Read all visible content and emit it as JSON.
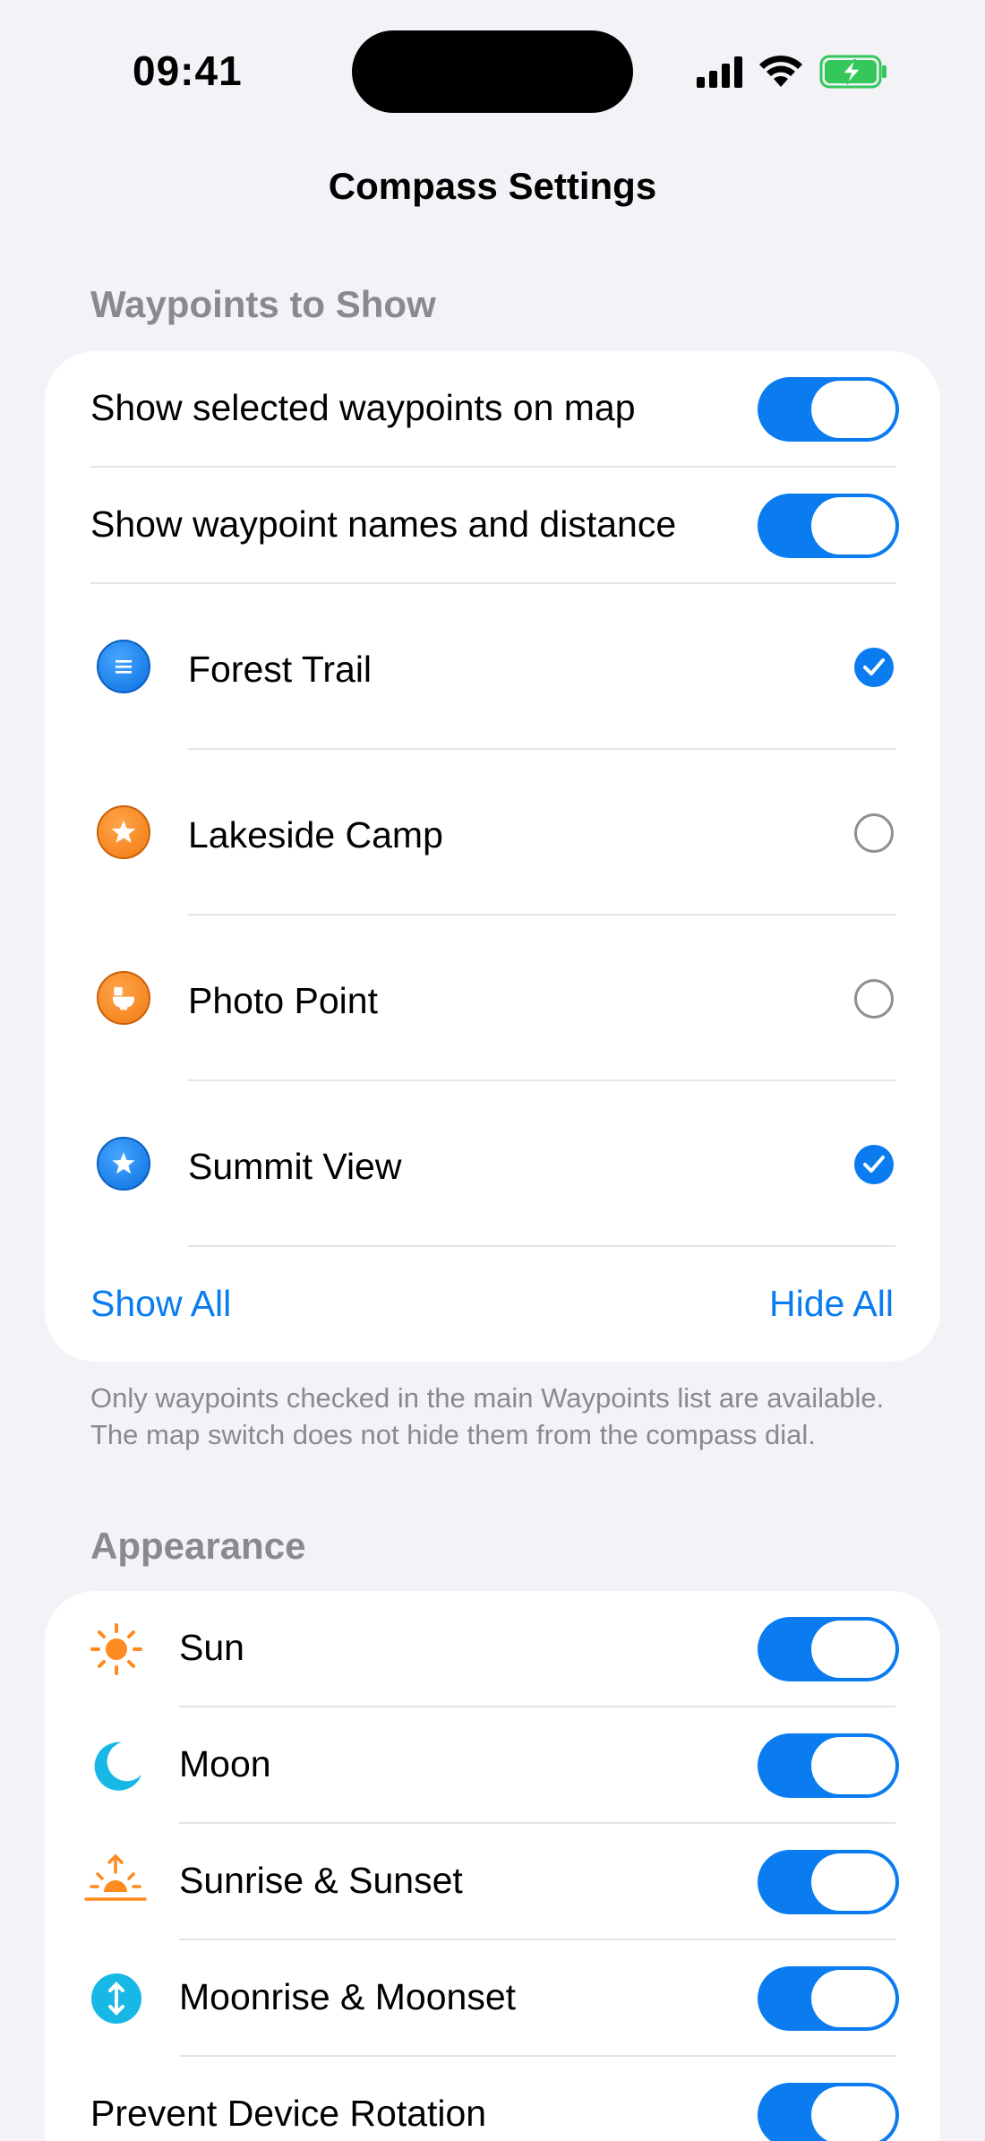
{
  "status": {
    "time": "09:41"
  },
  "nav": {
    "title": "Compass Settings"
  },
  "waypoints_section": {
    "header": "Waypoints to Show",
    "toggles": [
      {
        "label": "Show selected waypoints on map",
        "on": true
      },
      {
        "label": "Show waypoint names and distance",
        "on": true
      }
    ],
    "items": [
      {
        "label": "Forest Trail",
        "icon": "list-icon",
        "checked": true
      },
      {
        "label": "Lakeside Camp",
        "icon": "star-icon",
        "checked": false
      },
      {
        "label": "Photo Point",
        "icon": "restroom-icon",
        "checked": false
      },
      {
        "label": "Summit View",
        "icon": "star-icon",
        "checked": true
      }
    ],
    "show_all": "Show All",
    "hide_all": "Hide All",
    "footnote": "Only waypoints checked in the main Waypoints list are available. The map switch does not hide them from the compass dial."
  },
  "appearance_section": {
    "header": "Appearance",
    "rows": [
      {
        "label": "Sun",
        "icon": "sun-icon",
        "on": true
      },
      {
        "label": "Moon",
        "icon": "moon-icon",
        "on": true
      },
      {
        "label": "Sunrise & Sunset",
        "icon": "sunrise-icon",
        "on": true
      },
      {
        "label": "Moonrise & Moonset",
        "icon": "moonrise-icon",
        "on": true
      },
      {
        "label": "Prevent Device Rotation",
        "on": true
      }
    ]
  },
  "colors": {
    "accent": "#0a7cf0",
    "background": "#f2f2f7",
    "sun": "#ff8a1f",
    "moon": "#17b8e6"
  }
}
